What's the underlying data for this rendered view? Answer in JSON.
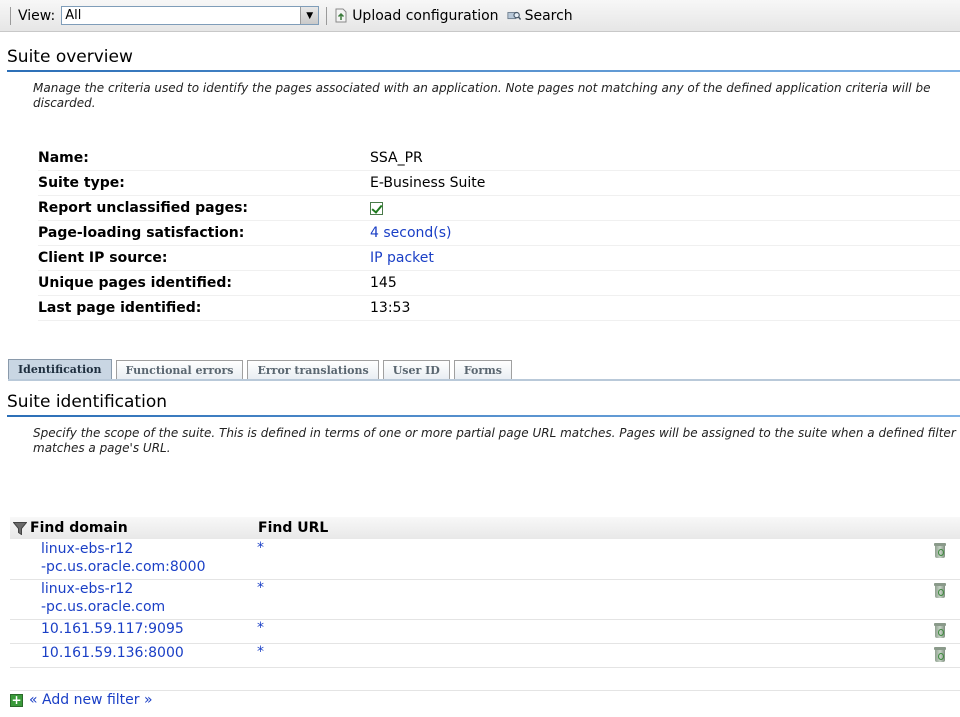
{
  "toolbar": {
    "view_label": "View:",
    "view_value": "All",
    "upload_label": "Upload configuration",
    "search_label": "Search"
  },
  "overview": {
    "title": "Suite overview",
    "description": "Manage the criteria used to identify the pages associated with an application. Note pages not matching any of the defined application criteria will be discarded.",
    "properties": [
      {
        "label": "Name:",
        "value": "SSA_PR"
      },
      {
        "label": "Suite type:",
        "value": "E-Business Suite"
      },
      {
        "label": "Report unclassified pages:",
        "value": "",
        "checked": true
      },
      {
        "label": "Page-loading satisfaction:",
        "value": "4 second(s)"
      },
      {
        "label": "Client IP source:",
        "value": "IP packet"
      },
      {
        "label": "Unique pages identified:",
        "value": "145"
      },
      {
        "label": "Last page identified:",
        "value": "13:53"
      }
    ]
  },
  "tabs": [
    {
      "label": "Identification",
      "active": true
    },
    {
      "label": "Functional errors"
    },
    {
      "label": "Error translations"
    },
    {
      "label": "User ID"
    },
    {
      "label": "Forms"
    }
  ],
  "identification": {
    "title": "Suite identification",
    "description": "Specify the scope of the suite. This is defined in terms of one or more partial page URL matches. Pages will be assigned to the suite when a defined filter matches a page's URL.",
    "columns": {
      "domain": "Find domain",
      "url": "Find URL"
    },
    "rows": [
      {
        "domain_line1": "linux-ebs-r12",
        "domain_line2": "-pc.us.oracle.com:8000",
        "url": "*"
      },
      {
        "domain_line1": "linux-ebs-r12",
        "domain_line2": "-pc.us.oracle.com",
        "url": "*"
      },
      {
        "domain_line1": "10.161.59.117:9095",
        "domain_line2": "",
        "url": "*"
      },
      {
        "domain_line1": "10.161.59.136:8000",
        "domain_line2": "",
        "url": "*"
      }
    ],
    "add_filter_label": "« Add new filter »"
  },
  "colors": {
    "link": "#1a3fc6",
    "accent": "#2c6fb7",
    "tab_active": "#c9d6e3"
  }
}
